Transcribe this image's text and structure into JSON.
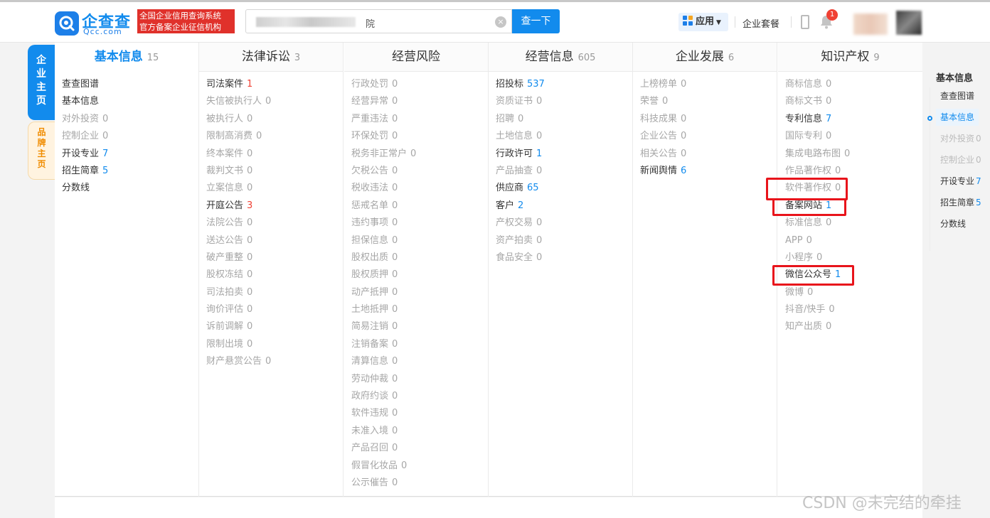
{
  "header": {
    "logo_name": "企查查",
    "logo_domain": "Qcc.com",
    "slogan_line1": "全国企业信用查询系统",
    "slogan_line2": "官方备案企业征信机构",
    "search_value_suffix": "院",
    "search_clear": "×",
    "search_button": "查一下",
    "app_label": "应用",
    "package_label": "企业套餐",
    "notification_count": "1"
  },
  "side_tabs": {
    "main": [
      "企",
      "业",
      "主",
      "页"
    ],
    "brand": [
      "品",
      "牌",
      "主",
      "页"
    ]
  },
  "columns": [
    {
      "title": "基本信息",
      "count": "15",
      "active": true,
      "items": [
        {
          "label": "查查图谱",
          "count": "",
          "state": "on",
          "tone": ""
        },
        {
          "label": "基本信息",
          "count": "",
          "state": "on",
          "tone": ""
        },
        {
          "label": "对外投资",
          "count": "0",
          "state": "dim",
          "tone": ""
        },
        {
          "label": "控制企业",
          "count": "0",
          "state": "dim",
          "tone": ""
        },
        {
          "label": "开设专业",
          "count": "7",
          "state": "on",
          "tone": "blue"
        },
        {
          "label": "招生简章",
          "count": "5",
          "state": "on",
          "tone": "blue"
        },
        {
          "label": "分数线",
          "count": "",
          "state": "on",
          "tone": ""
        }
      ]
    },
    {
      "title": "法律诉讼",
      "count": "3",
      "active": false,
      "items": [
        {
          "label": "司法案件",
          "count": "1",
          "state": "on",
          "tone": "red"
        },
        {
          "label": "失信被执行人",
          "count": "0",
          "state": "dim",
          "tone": ""
        },
        {
          "label": "被执行人",
          "count": "0",
          "state": "dim",
          "tone": ""
        },
        {
          "label": "限制高消费",
          "count": "0",
          "state": "dim",
          "tone": ""
        },
        {
          "label": "终本案件",
          "count": "0",
          "state": "dim",
          "tone": ""
        },
        {
          "label": "裁判文书",
          "count": "0",
          "state": "dim",
          "tone": ""
        },
        {
          "label": "立案信息",
          "count": "0",
          "state": "dim",
          "tone": ""
        },
        {
          "label": "开庭公告",
          "count": "3",
          "state": "on",
          "tone": "red"
        },
        {
          "label": "法院公告",
          "count": "0",
          "state": "dim",
          "tone": ""
        },
        {
          "label": "送达公告",
          "count": "0",
          "state": "dim",
          "tone": ""
        },
        {
          "label": "破产重整",
          "count": "0",
          "state": "dim",
          "tone": ""
        },
        {
          "label": "股权冻结",
          "count": "0",
          "state": "dim",
          "tone": ""
        },
        {
          "label": "司法拍卖",
          "count": "0",
          "state": "dim",
          "tone": ""
        },
        {
          "label": "询价评估",
          "count": "0",
          "state": "dim",
          "tone": ""
        },
        {
          "label": "诉前调解",
          "count": "0",
          "state": "dim",
          "tone": ""
        },
        {
          "label": "限制出境",
          "count": "0",
          "state": "dim",
          "tone": ""
        },
        {
          "label": "财产悬赏公告",
          "count": "0",
          "state": "dim",
          "tone": ""
        }
      ]
    },
    {
      "title": "经营风险",
      "count": "",
      "active": false,
      "items": [
        {
          "label": "行政处罚",
          "count": "0",
          "state": "dim",
          "tone": ""
        },
        {
          "label": "经营异常",
          "count": "0",
          "state": "dim",
          "tone": ""
        },
        {
          "label": "严重违法",
          "count": "0",
          "state": "dim",
          "tone": ""
        },
        {
          "label": "环保处罚",
          "count": "0",
          "state": "dim",
          "tone": ""
        },
        {
          "label": "税务非正常户",
          "count": "0",
          "state": "dim",
          "tone": ""
        },
        {
          "label": "欠税公告",
          "count": "0",
          "state": "dim",
          "tone": ""
        },
        {
          "label": "税收违法",
          "count": "0",
          "state": "dim",
          "tone": ""
        },
        {
          "label": "惩戒名单",
          "count": "0",
          "state": "dim",
          "tone": ""
        },
        {
          "label": "违约事项",
          "count": "0",
          "state": "dim",
          "tone": ""
        },
        {
          "label": "担保信息",
          "count": "0",
          "state": "dim",
          "tone": ""
        },
        {
          "label": "股权出质",
          "count": "0",
          "state": "dim",
          "tone": ""
        },
        {
          "label": "股权质押",
          "count": "0",
          "state": "dim",
          "tone": ""
        },
        {
          "label": "动产抵押",
          "count": "0",
          "state": "dim",
          "tone": ""
        },
        {
          "label": "土地抵押",
          "count": "0",
          "state": "dim",
          "tone": ""
        },
        {
          "label": "简易注销",
          "count": "0",
          "state": "dim",
          "tone": ""
        },
        {
          "label": "注销备案",
          "count": "0",
          "state": "dim",
          "tone": ""
        },
        {
          "label": "清算信息",
          "count": "0",
          "state": "dim",
          "tone": ""
        },
        {
          "label": "劳动仲裁",
          "count": "0",
          "state": "dim",
          "tone": ""
        },
        {
          "label": "政府约谈",
          "count": "0",
          "state": "dim",
          "tone": ""
        },
        {
          "label": "软件违规",
          "count": "0",
          "state": "dim",
          "tone": ""
        },
        {
          "label": "未准入境",
          "count": "0",
          "state": "dim",
          "tone": ""
        },
        {
          "label": "产品召回",
          "count": "0",
          "state": "dim",
          "tone": ""
        },
        {
          "label": "假冒化妆品",
          "count": "0",
          "state": "dim",
          "tone": ""
        },
        {
          "label": "公示催告",
          "count": "0",
          "state": "dim",
          "tone": ""
        }
      ]
    },
    {
      "title": "经营信息",
      "count": "605",
      "active": false,
      "items": [
        {
          "label": "招投标",
          "count": "537",
          "state": "on",
          "tone": "blue"
        },
        {
          "label": "资质证书",
          "count": "0",
          "state": "dim",
          "tone": ""
        },
        {
          "label": "招聘",
          "count": "0",
          "state": "dim",
          "tone": ""
        },
        {
          "label": "土地信息",
          "count": "0",
          "state": "dim",
          "tone": ""
        },
        {
          "label": "行政许可",
          "count": "1",
          "state": "on",
          "tone": "blue"
        },
        {
          "label": "产品抽查",
          "count": "0",
          "state": "dim",
          "tone": ""
        },
        {
          "label": "供应商",
          "count": "65",
          "state": "on",
          "tone": "blue"
        },
        {
          "label": "客户",
          "count": "2",
          "state": "on",
          "tone": "blue"
        },
        {
          "label": "产权交易",
          "count": "0",
          "state": "dim",
          "tone": ""
        },
        {
          "label": "资产拍卖",
          "count": "0",
          "state": "dim",
          "tone": ""
        },
        {
          "label": "食品安全",
          "count": "0",
          "state": "dim",
          "tone": ""
        }
      ]
    },
    {
      "title": "企业发展",
      "count": "6",
      "active": false,
      "items": [
        {
          "label": "上榜榜单",
          "count": "0",
          "state": "dim",
          "tone": ""
        },
        {
          "label": "荣誉",
          "count": "0",
          "state": "dim",
          "tone": ""
        },
        {
          "label": "科技成果",
          "count": "0",
          "state": "dim",
          "tone": ""
        },
        {
          "label": "企业公告",
          "count": "0",
          "state": "dim",
          "tone": ""
        },
        {
          "label": "相关公告",
          "count": "0",
          "state": "dim",
          "tone": ""
        },
        {
          "label": "新闻舆情",
          "count": "6",
          "state": "on",
          "tone": "blue"
        }
      ]
    },
    {
      "title": "知识产权",
      "count": "9",
      "active": false,
      "items": [
        {
          "label": "商标信息",
          "count": "0",
          "state": "dim",
          "tone": ""
        },
        {
          "label": "商标文书",
          "count": "0",
          "state": "dim",
          "tone": ""
        },
        {
          "label": "专利信息",
          "count": "7",
          "state": "on",
          "tone": "blue"
        },
        {
          "label": "国际专利",
          "count": "0",
          "state": "dim",
          "tone": ""
        },
        {
          "label": "集成电路布图",
          "count": "0",
          "state": "dim",
          "tone": ""
        },
        {
          "label": "作品著作权",
          "count": "0",
          "state": "dim",
          "tone": ""
        },
        {
          "label": "软件著作权",
          "count": "0",
          "state": "dim",
          "tone": ""
        },
        {
          "label": "备案网站",
          "count": "1",
          "state": "on",
          "tone": "blue"
        },
        {
          "label": "标准信息",
          "count": "0",
          "state": "dim",
          "tone": ""
        },
        {
          "label": "APP",
          "count": "0",
          "state": "dim",
          "tone": ""
        },
        {
          "label": "小程序",
          "count": "0",
          "state": "dim",
          "tone": ""
        },
        {
          "label": "微信公众号",
          "count": "1",
          "state": "on",
          "tone": "blue"
        },
        {
          "label": "微博",
          "count": "0",
          "state": "dim",
          "tone": ""
        },
        {
          "label": "抖音/快手",
          "count": "0",
          "state": "dim",
          "tone": ""
        },
        {
          "label": "知产出质",
          "count": "0",
          "state": "dim",
          "tone": ""
        }
      ]
    }
  ],
  "right_nav": {
    "title": "基本信息",
    "items": [
      {
        "label": "查查图谱",
        "count": "",
        "state": "on"
      },
      {
        "label": "基本信息",
        "count": "",
        "state": "active"
      },
      {
        "label": "对外投资",
        "count": "0",
        "state": "dim"
      },
      {
        "label": "控制企业",
        "count": "0",
        "state": "dim"
      },
      {
        "label": "开设专业",
        "count": "7",
        "state": "on"
      },
      {
        "label": "招生简章",
        "count": "5",
        "state": "on"
      },
      {
        "label": "分数线",
        "count": "",
        "state": "on"
      }
    ]
  },
  "watermark": "CSDN @未完结的牵挂",
  "colors": {
    "brand_blue": "#128bed",
    "highlight_red": "#e8141b",
    "slogan_red": "#e0312b",
    "dim_text": "#a6a6a6"
  }
}
